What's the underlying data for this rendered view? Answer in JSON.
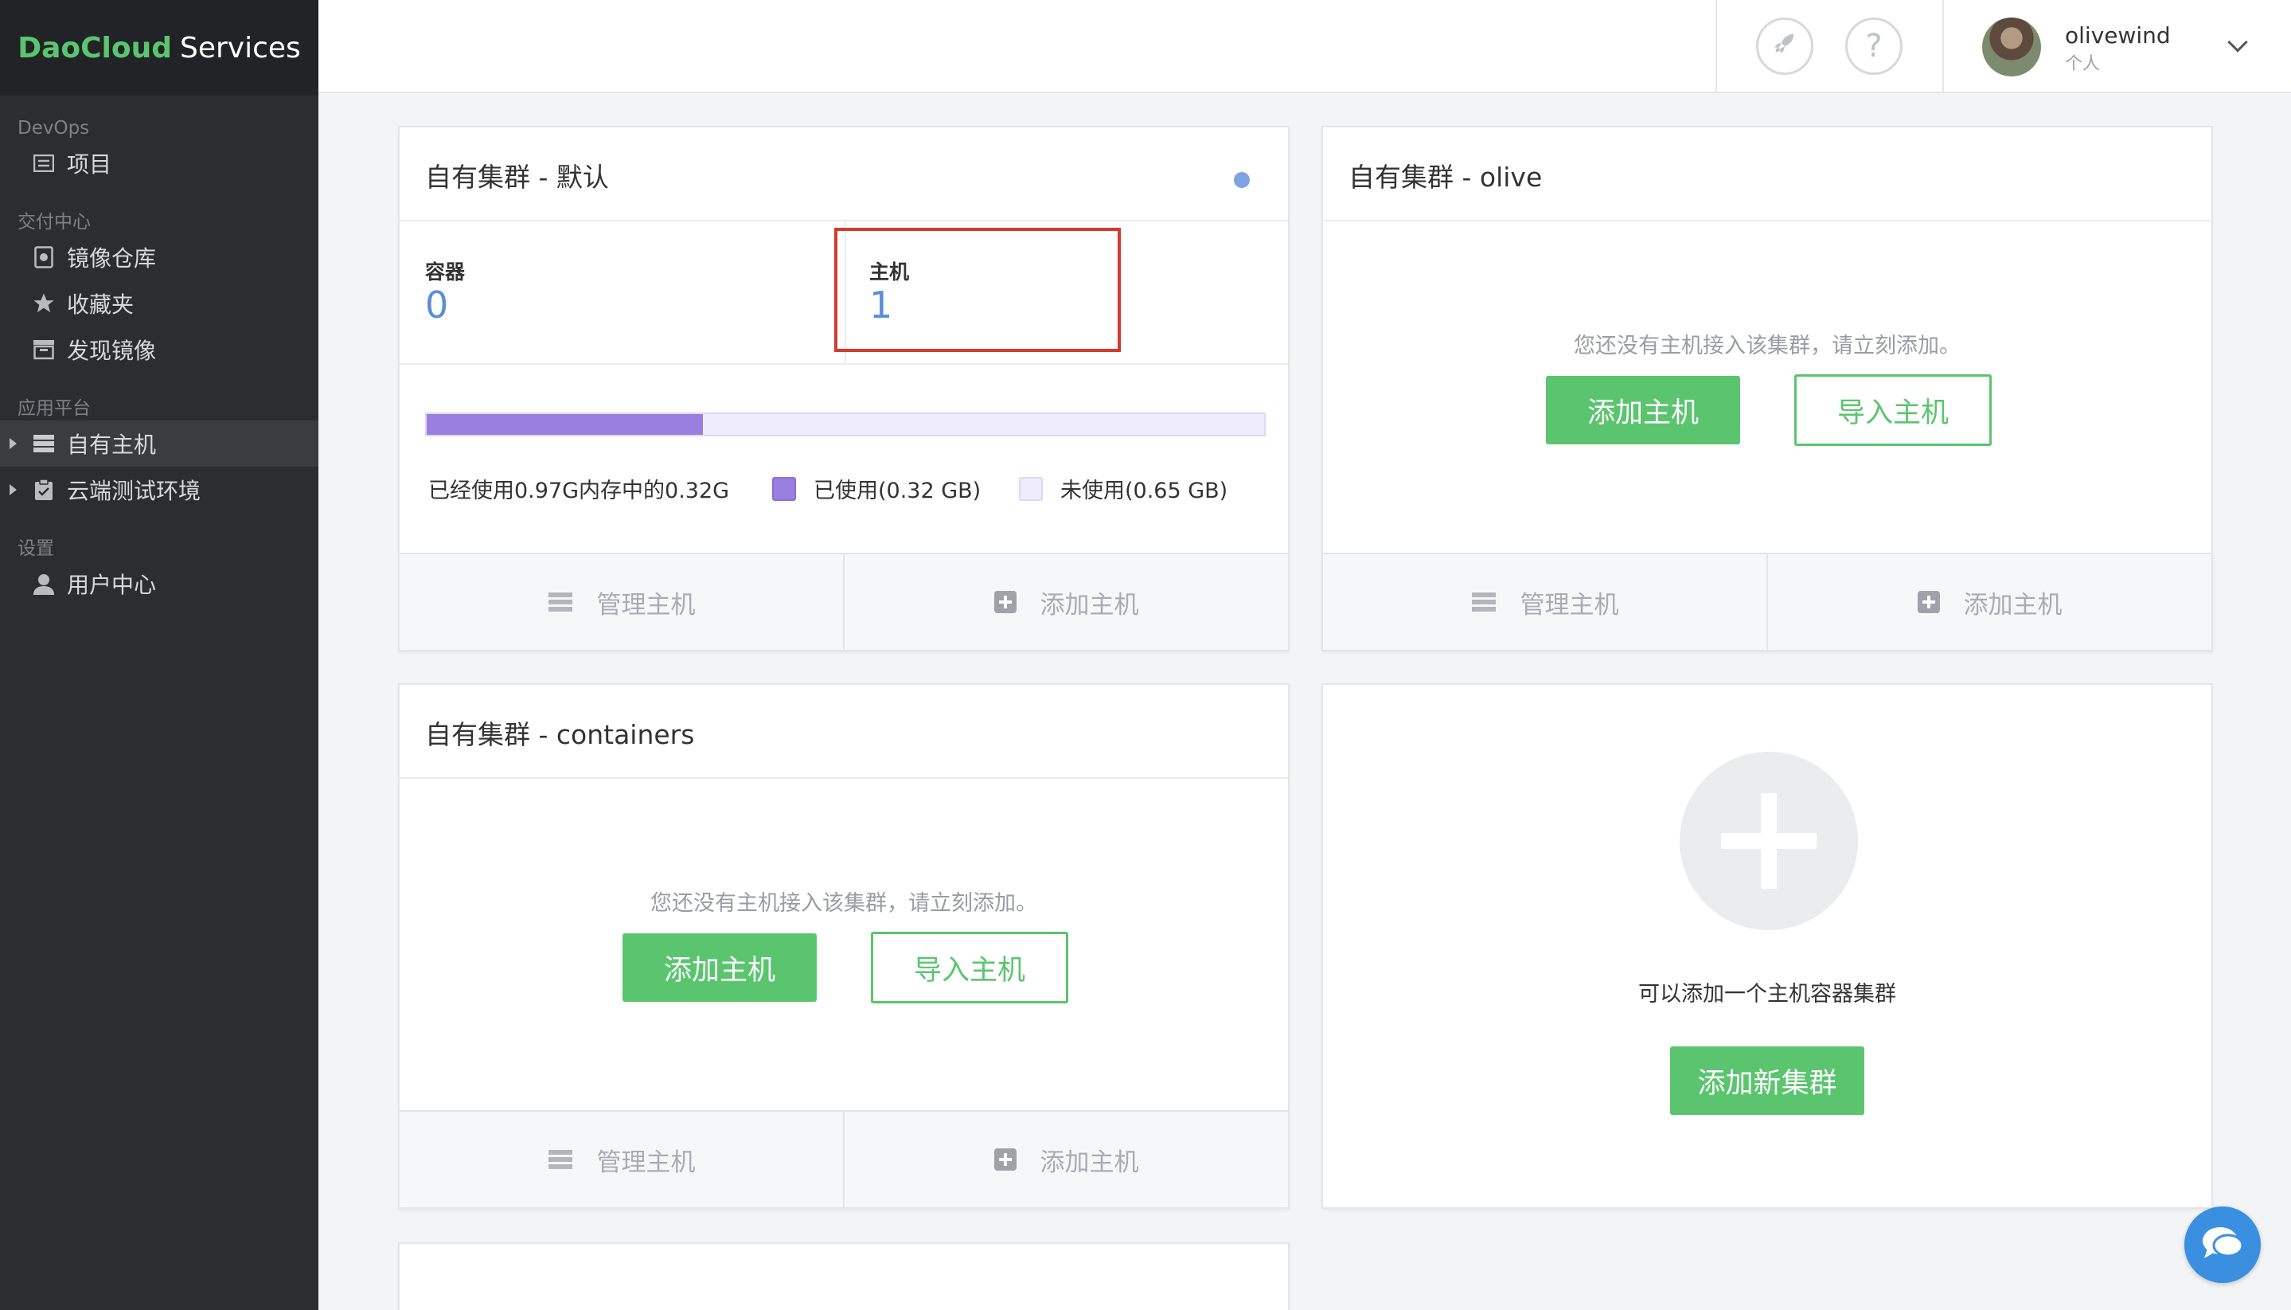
{
  "brand": {
    "part1": "DaoCloud",
    "part2": "Services"
  },
  "sidebar": {
    "sections": [
      {
        "label": "DevOps",
        "items": [
          {
            "label": "项目",
            "icon": "project-icon"
          }
        ]
      },
      {
        "label": "交付中心",
        "items": [
          {
            "label": "镜像仓库",
            "icon": "registry-icon"
          },
          {
            "label": "收藏夹",
            "icon": "star-icon"
          },
          {
            "label": "发现镜像",
            "icon": "discover-icon"
          }
        ]
      },
      {
        "label": "应用平台",
        "items": [
          {
            "label": "自有主机",
            "icon": "server-icon",
            "active": true
          },
          {
            "label": "云端测试环境",
            "icon": "clipboard-icon"
          }
        ]
      },
      {
        "label": "设置",
        "items": [
          {
            "label": "用户中心",
            "icon": "user-icon"
          }
        ]
      }
    ]
  },
  "topbar": {
    "rocket_icon": "rocket-icon",
    "help_text": "?",
    "user": {
      "name": "olivewind",
      "role": "个人"
    }
  },
  "cards": {
    "default": {
      "title": "自有集群 - 默认",
      "status_color": "#7fa3e3",
      "container_label": "容器",
      "container_value": "0",
      "host_label": "主机",
      "host_value": "1",
      "memory_used_fraction": 0.33,
      "usage_text": "已经使用0.97G内存中的0.32G",
      "legend_used": "已使用(0.32 GB)",
      "legend_unused": "未使用(0.65 GB)",
      "used_color": "#9b7fe0",
      "unused_color": "#efedfb"
    },
    "olive": {
      "title": "自有集群 - olive",
      "empty_message": "您还没有主机接入该集群，请立刻添加。",
      "add_button": "添加主机",
      "import_button": "导入主机"
    },
    "containers": {
      "title": "自有集群 - containers",
      "empty_message": "您还没有主机接入该集群，请立刻添加。",
      "add_button": "添加主机",
      "import_button": "导入主机"
    },
    "new_cluster": {
      "message": "可以添加一个主机容器集群",
      "button": "添加新集群"
    },
    "footer": {
      "manage": "管理主机",
      "add": "添加主机"
    }
  },
  "colors": {
    "accent": "#5ac56e",
    "sidebar_bg": "#2b2d30",
    "highlight": "#d23b2f"
  }
}
